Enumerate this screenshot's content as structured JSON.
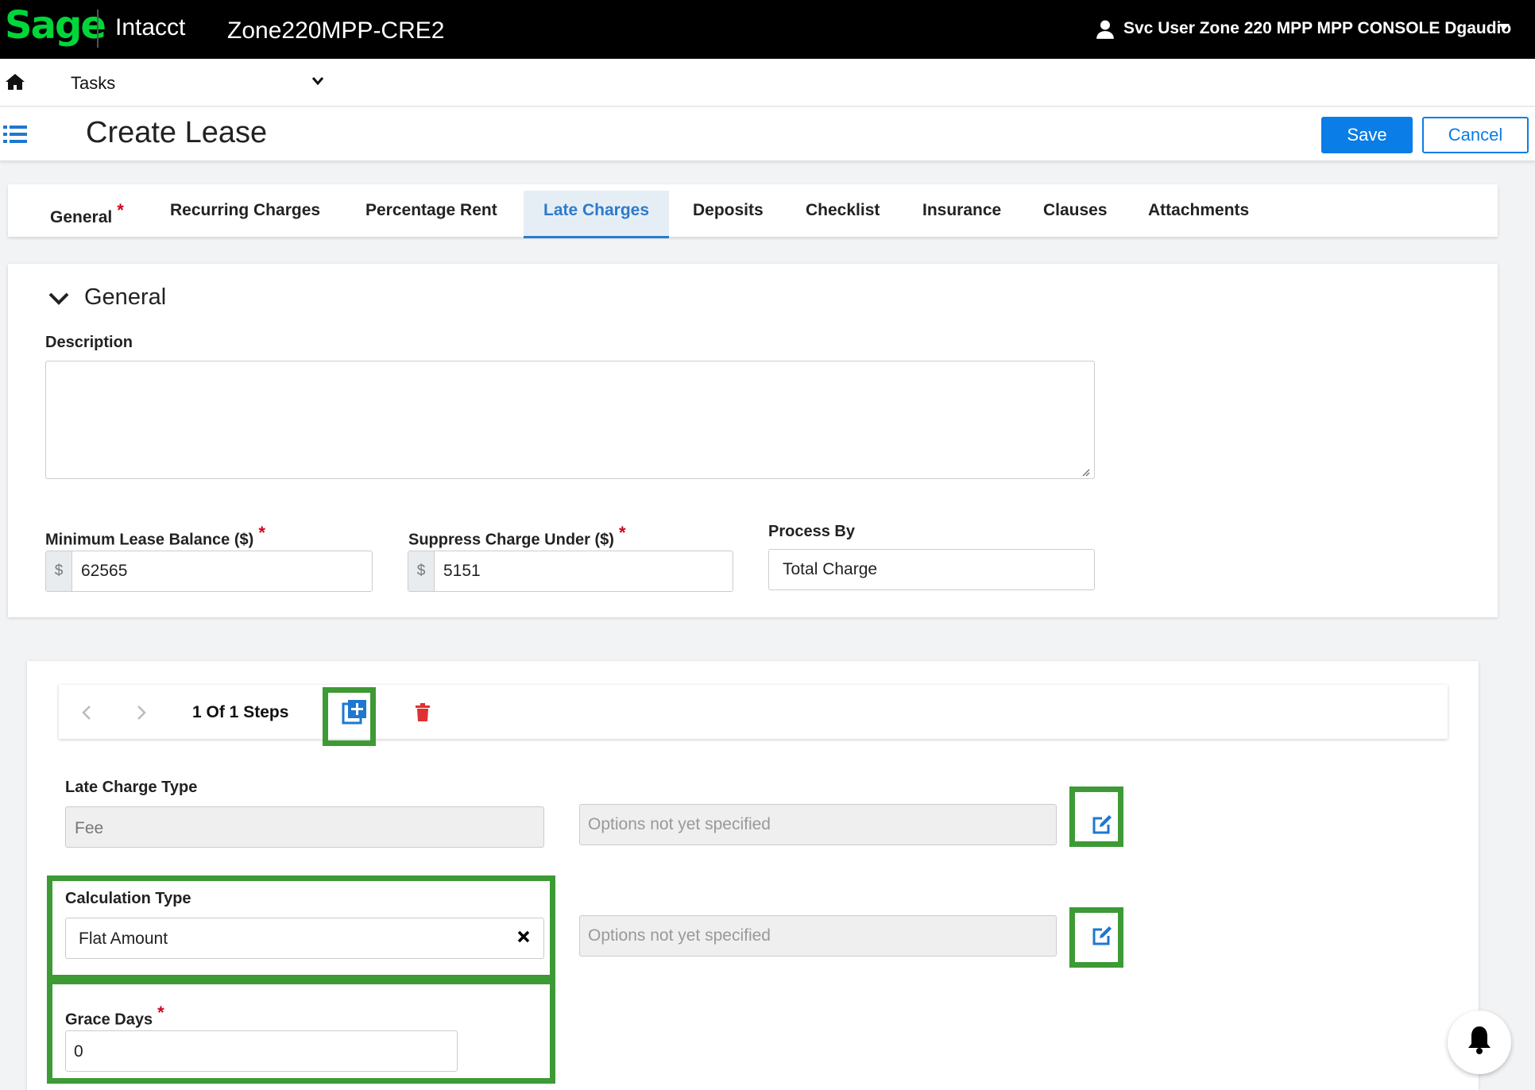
{
  "topbar": {
    "logo": "Sage",
    "product": "Intacct",
    "company": "Zone220MPP-CRE2",
    "user": "Svc User Zone 220 MPP MPP CONSOLE Dgaudio"
  },
  "tasks": {
    "label": "Tasks"
  },
  "header": {
    "title": "Create Lease",
    "save_label": "Save",
    "cancel_label": "Cancel"
  },
  "tabs": [
    {
      "label": "General",
      "required": true
    },
    {
      "label": "Recurring Charges"
    },
    {
      "label": "Percentage Rent"
    },
    {
      "label": "Late Charges",
      "active": true
    },
    {
      "label": "Deposits"
    },
    {
      "label": "Checklist"
    },
    {
      "label": "Insurance"
    },
    {
      "label": "Clauses"
    },
    {
      "label": "Attachments"
    }
  ],
  "general": {
    "section_title": "General",
    "description_label": "Description",
    "description_value": "",
    "min_balance_label": "Minimum Lease Balance ($)",
    "min_balance_prefix": "$",
    "min_balance_value": "62565",
    "suppress_label": "Suppress Charge Under ($)",
    "suppress_prefix": "$",
    "suppress_value": "5151",
    "process_by_label": "Process By",
    "process_by_value": "Total Charge"
  },
  "steps": {
    "counter": "1 Of 1 Steps",
    "late_charge_type_label": "Late Charge Type",
    "late_charge_type_value": "Fee",
    "late_charge_options": "Options not yet specified",
    "calculation_type_label": "Calculation Type",
    "calculation_type_value": "Flat Amount",
    "calculation_options": "Options not yet specified",
    "grace_days_label": "Grace Days",
    "grace_days_value": "0"
  },
  "colors": {
    "brand_green": "#00d639",
    "accent_blue": "#0a7de6",
    "highlight_green": "#3d9a35",
    "required_red": "#d0021b"
  }
}
